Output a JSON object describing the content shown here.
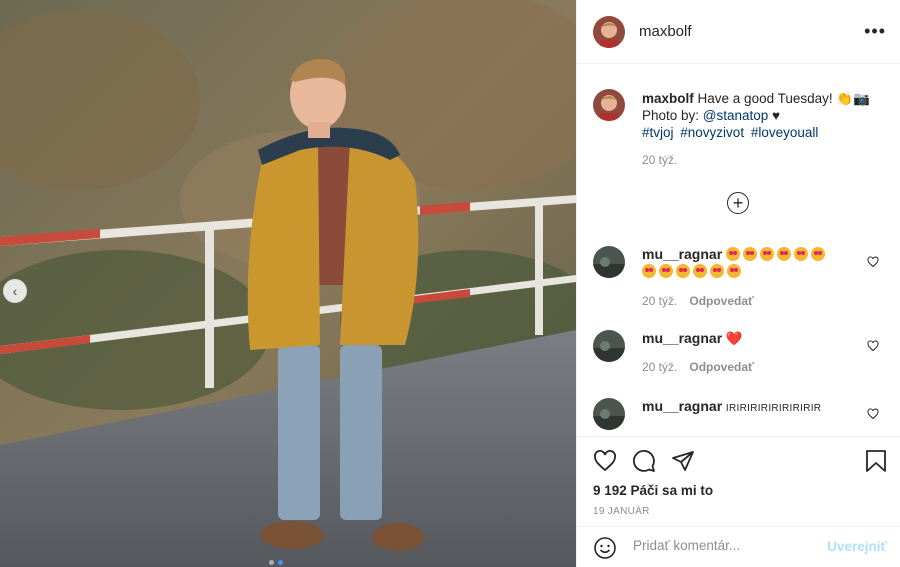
{
  "post": {
    "username": "maxbolf",
    "more_icon": "more-horizontal-icon"
  },
  "caption": {
    "username": "maxbolf",
    "line1": "Have a good Tuesday! 👏📷",
    "line2_prefix": "Photo by: ",
    "mention": "@stanatop",
    "line2_suffix": " ♥",
    "tags": [
      "#tvjoj",
      "#novyzivot",
      "#loveyouall"
    ],
    "time": "20 týž."
  },
  "comments": [
    {
      "username": "mu__ragnar",
      "text": "",
      "emoji_count": 12,
      "time": "20 týž.",
      "reply": "Odpovedať"
    },
    {
      "username": "mu__ragnar",
      "text": "❤️",
      "emoji_count": 0,
      "time": "20 týž.",
      "reply": "Odpovedať"
    },
    {
      "username": "mu__ragnar",
      "text": "IRIRIRIRIRIRIRIRIR",
      "emoji_count": 0,
      "time": "",
      "reply": ""
    }
  ],
  "actions": {
    "likes": "9 192 Páči sa mi to",
    "date": "19 JANUÁR"
  },
  "add_comment": {
    "placeholder": "Pridať komentár...",
    "post_label": "Uverejniť"
  },
  "colors": {
    "link": "#00376b",
    "post_button": "#b2dffc",
    "secondary": "#8e8e8e"
  }
}
